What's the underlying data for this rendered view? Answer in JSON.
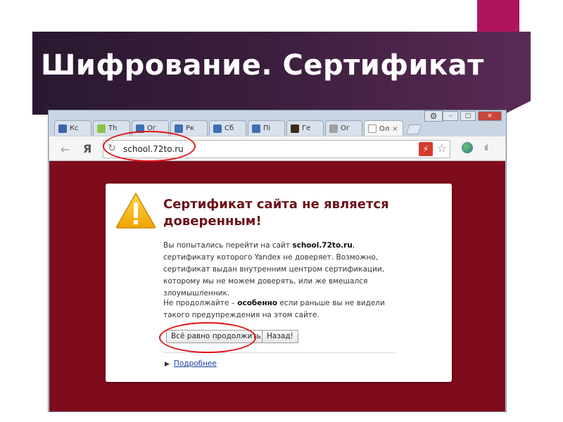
{
  "slide": {
    "title": "Шифрование. Сертификат",
    "colors": {
      "title_bar": "#3a1e3c",
      "accent": "#b0155c"
    }
  },
  "browser": {
    "window_controls": [
      "–",
      "□",
      "×"
    ],
    "settings_icon": "gear-icon",
    "tabs": [
      {
        "label": "Кс",
        "icon": "person-icon",
        "icon_color": "#3b64b0"
      },
      {
        "label": "Th",
        "icon": "android-icon",
        "icon_color": "#8bc34a"
      },
      {
        "label": "Ог",
        "icon": "site-icon",
        "icon_color": "#3f6fb5"
      },
      {
        "label": "Рк",
        "icon": "site-icon",
        "icon_color": "#3f6fb5"
      },
      {
        "label": "Сб",
        "icon": "site-icon",
        "icon_color": "#3f6fb5"
      },
      {
        "label": "Пі",
        "icon": "site-icon",
        "icon_color": "#3f6fb5"
      },
      {
        "label": "Ге",
        "icon": "portrait-icon",
        "icon_color": "#3a2a1a"
      },
      {
        "label": "Ог",
        "icon": "document-icon",
        "icon_color": "#a0a0a0"
      },
      {
        "label": "Ол",
        "icon": "page-icon",
        "icon_color": "#ffffff",
        "active": true,
        "close": "×"
      }
    ],
    "toolbar": {
      "back": "←",
      "logo": "Я",
      "reload": "↻",
      "url": "school.72to.ru",
      "shield": "⚡",
      "star": "☆",
      "bars": "ııl"
    },
    "warning": {
      "heading": "Сертификат сайта не является доверенным!",
      "para1_before": "Вы попытались перейти на сайт ",
      "para1_host": "school.72to.ru",
      "para1_after": ", сертификату которого Yandex не доверяет. Возможно, сертификат выдан внутренним центром сертификации, которому мы не можем доверять, или же вмешался злоумышленник.",
      "para2_before": "Не продолжайте – ",
      "para2_bold": "особенно",
      "para2_after": " если раньше вы не видели такого предупреждения на этом сайте.",
      "proceed_label": "Всё равно продолжить",
      "back_label": "Назад!",
      "details_label": "Подробнее",
      "details_marker": "▶"
    },
    "colors": {
      "page_bg": "#7e0c1c",
      "heading": "#6b1218",
      "link": "#1a3f9e",
      "annotation": "#e21416"
    }
  }
}
